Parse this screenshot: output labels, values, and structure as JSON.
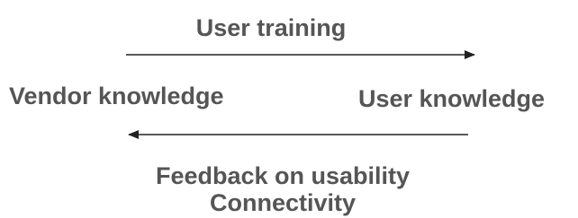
{
  "labels": {
    "top": "User training",
    "left": "Vendor knowledge",
    "right": "User knowledge",
    "bottom_line1": "Feedback on usability",
    "bottom_line2": "Connectivity"
  },
  "colors": {
    "text": "#555555",
    "arrow": "#222222"
  }
}
